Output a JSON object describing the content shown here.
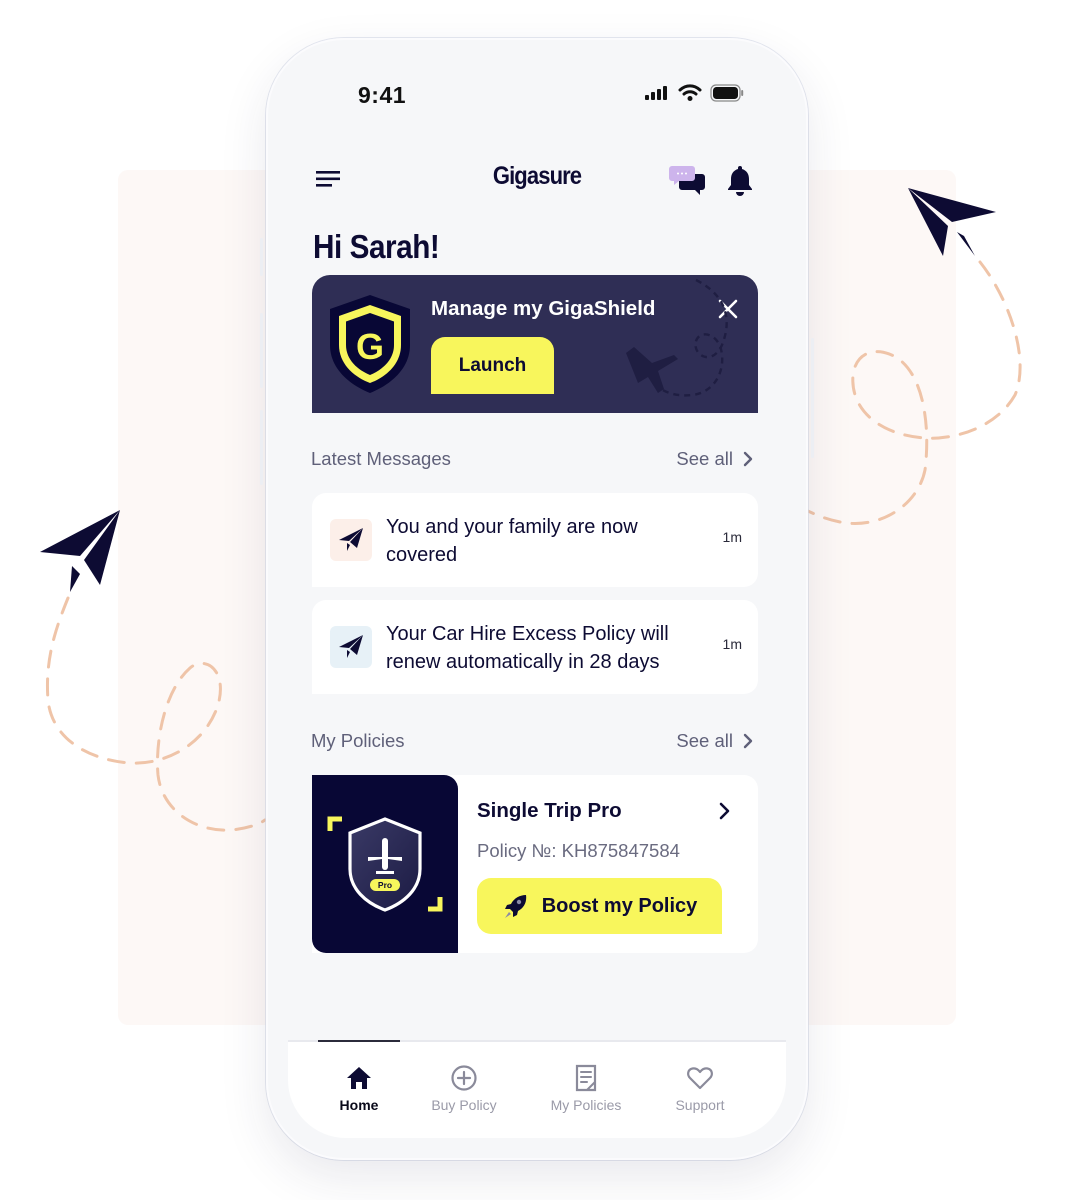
{
  "status_bar": {
    "time": "9:41"
  },
  "app_bar": {
    "brand": "Gigasure",
    "icons": [
      "menu-icon",
      "chat-icon",
      "bell-icon"
    ]
  },
  "greeting": "Hi Sarah!",
  "banner": {
    "title": "Manage my GigaShield",
    "button_label": "Launch",
    "shield_letter": "G",
    "close_icon": "close-icon"
  },
  "messages": {
    "section_title": "Latest Messages",
    "see_all": "See all",
    "items": [
      {
        "text": "You and your family are now covered",
        "time": "1m",
        "icon": "paper-plane-icon",
        "icon_bg": "#fcefe9"
      },
      {
        "text": "Your Car Hire Excess Policy will renew automatically in 28 days",
        "time": "1m",
        "icon": "paper-plane-icon",
        "icon_bg": "#e7f1f7"
      }
    ]
  },
  "policies": {
    "section_title": "My Policies",
    "see_all": "See all",
    "items": [
      {
        "name": "Single Trip Pro",
        "number": "Policy №: KH875847584",
        "badge": "Pro",
        "button_label": "Boost my Policy"
      }
    ]
  },
  "tabbar": {
    "active": "Home",
    "tabs": [
      {
        "label": "Home",
        "icon": "home-icon"
      },
      {
        "label": "Buy Policy",
        "icon": "plus-circle-icon"
      },
      {
        "label": "My Policies",
        "icon": "document-icon"
      },
      {
        "label": "Support",
        "icon": "heart-icon"
      }
    ]
  },
  "colors": {
    "navy": "#0d0b33",
    "banner_bg": "#2f2e55",
    "accent_yellow": "#f8f65c",
    "dash_peach": "#efc4a8",
    "muted_text": "#5f6079"
  }
}
